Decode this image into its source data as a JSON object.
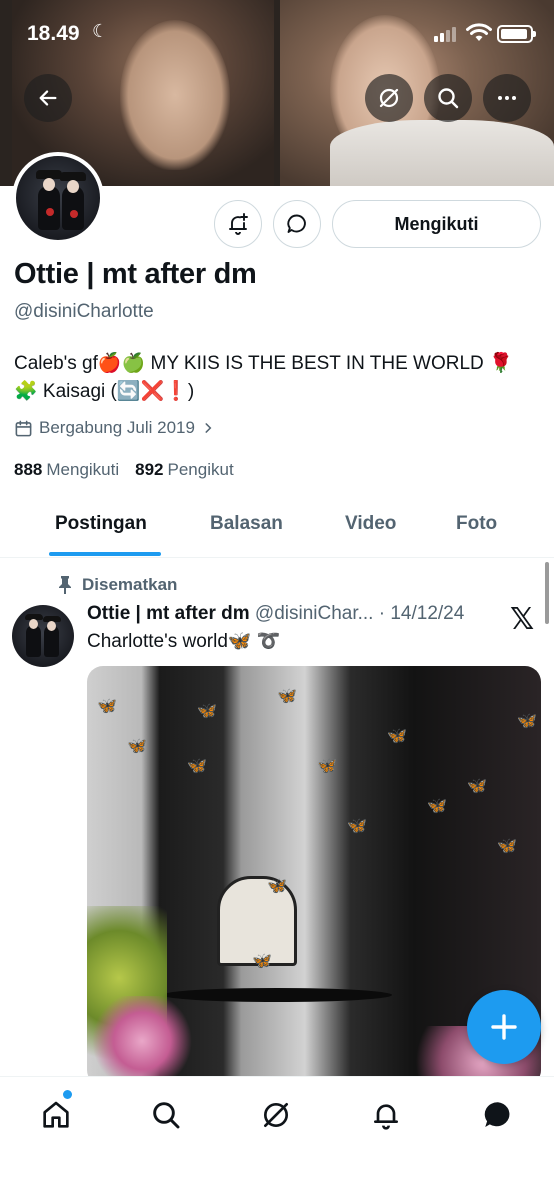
{
  "status_bar": {
    "time": "18.49"
  },
  "profile": {
    "name": "Ottie | mt after dm",
    "handle": "@disiniCharlotte",
    "bio": "Caleb's gf🍎🍏 MY KIIS IS THE BEST IN THE WORLD 🌹🧩 Kaisagi (🔄❌❗)",
    "joined": "Bergabung Juli 2019",
    "following_count": "888",
    "following_label": "Mengikuti",
    "followers_count": "892",
    "followers_label": "Pengikut",
    "follow_button": "Mengikuti"
  },
  "tabs": [
    {
      "label": "Postingan",
      "active": true
    },
    {
      "label": "Balasan",
      "active": false
    },
    {
      "label": "Video",
      "active": false
    },
    {
      "label": "Foto",
      "active": false
    }
  ],
  "post": {
    "pinned_label": "Disematkan",
    "author_name": "Ottie | mt after dm",
    "author_handle": "@disiniChar...",
    "separator": "·",
    "date": "14/12/24",
    "text": "Charlotte's world🦋 ➰"
  },
  "icons": {
    "back": "arrow-left-icon",
    "grok": "grok-icon",
    "search": "search-icon",
    "more": "more-icon",
    "notify": "bell-plus-icon",
    "message": "message-icon",
    "calendar": "calendar-icon",
    "pin": "pin-icon",
    "x": "x-logo-icon",
    "compose": "plus-icon",
    "home": "home-icon",
    "explore": "search-icon",
    "grok_nav": "grok-icon",
    "notifications": "bell-icon",
    "messages": "message-filled-icon"
  },
  "colors": {
    "accent": "#1d9bf0",
    "text": "#0f1419",
    "muted": "#536471"
  }
}
